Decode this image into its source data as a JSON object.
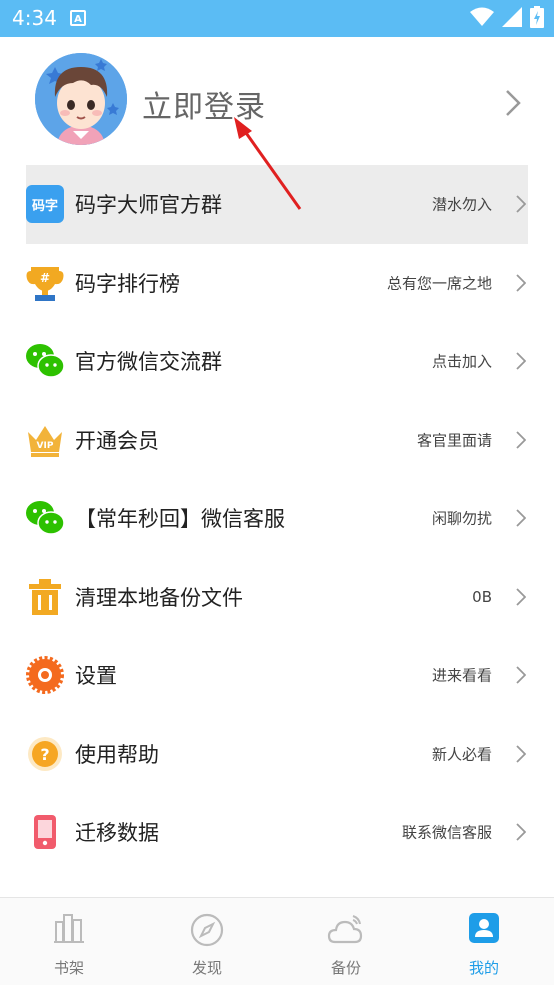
{
  "status_bar": {
    "time": "4:34",
    "notification_icon": "A"
  },
  "profile": {
    "login_text": "立即登录"
  },
  "menu": [
    {
      "label": "码字大师官方群",
      "hint": "潜水勿入",
      "icon": "qq-group-icon"
    },
    {
      "label": "码字排行榜",
      "hint": "总有您一席之地",
      "icon": "trophy-icon"
    },
    {
      "label": "官方微信交流群",
      "hint": "点击加入",
      "icon": "wechat-icon"
    },
    {
      "label": "开通会员",
      "hint": "客官里面请",
      "icon": "vip-crown-icon"
    },
    {
      "label": "【常年秒回】微信客服",
      "hint": "闲聊勿扰",
      "icon": "wechat-icon"
    },
    {
      "label": "清理本地备份文件",
      "hint": "0B",
      "icon": "trash-icon"
    },
    {
      "label": "设置",
      "hint": "进来看看",
      "icon": "gear-icon"
    },
    {
      "label": "使用帮助",
      "hint": "新人必看",
      "icon": "help-icon"
    },
    {
      "label": "迁移数据",
      "hint": "联系微信客服",
      "icon": "phone-migrate-icon"
    }
  ],
  "tabs": [
    {
      "label": "书架",
      "icon": "bookshelf-icon"
    },
    {
      "label": "发现",
      "icon": "compass-icon"
    },
    {
      "label": "备份",
      "icon": "cloud-icon"
    },
    {
      "label": "我的",
      "icon": "user-icon"
    }
  ],
  "colors": {
    "status_bar": "#5bbcf4",
    "accent": "#1e9de8",
    "annotation_arrow": "#e02020"
  }
}
